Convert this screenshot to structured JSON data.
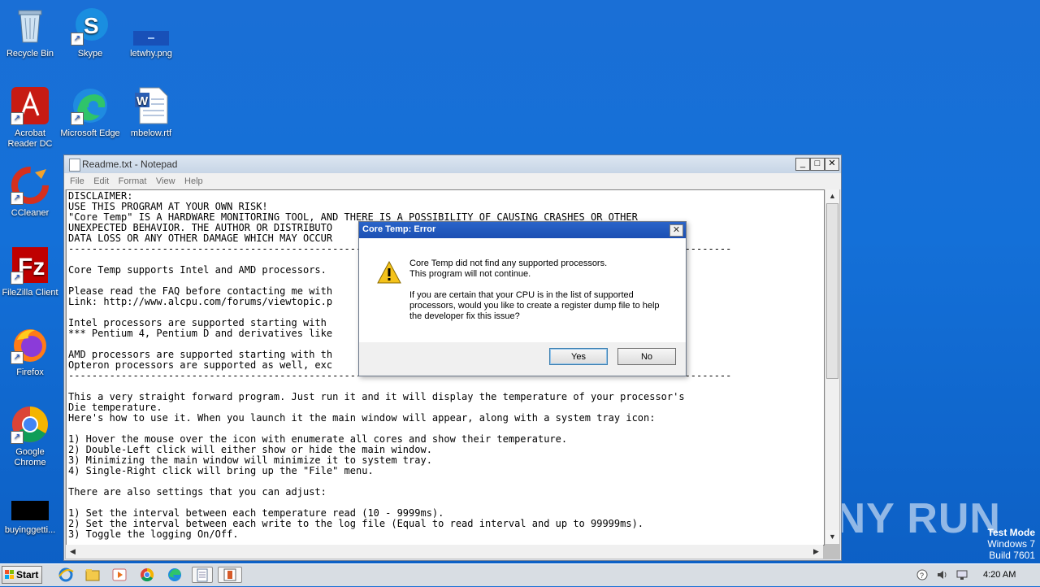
{
  "desktop": {
    "icons": [
      {
        "label": "Recycle Bin"
      },
      {
        "label": "Skype"
      },
      {
        "label": "letwhy.png"
      },
      {
        "label": "Acrobat Reader DC"
      },
      {
        "label": "Microsoft Edge"
      },
      {
        "label": "mbelow.rtf"
      },
      {
        "label": "CCleaner"
      },
      {
        "label": "FileZilla Client"
      },
      {
        "label": "Firefox"
      },
      {
        "label": "Google Chrome"
      },
      {
        "label": "buyinggetti..."
      }
    ],
    "watermark": "ANY RUN",
    "test_mode": {
      "line1": "Test Mode",
      "line2": "Windows 7",
      "line3": "Build 7601"
    }
  },
  "notepad": {
    "title": "Readme.txt - Notepad",
    "menu": [
      "File",
      "Edit",
      "Format",
      "View",
      "Help"
    ],
    "text": "DISCLAIMER:\nUSE THIS PROGRAM AT YOUR OWN RISK!\n\"Core Temp\" IS A HARDWARE MONITORING TOOL, AND THERE IS A POSSIBILITY OF CAUSING CRASHES OR OTHER\nUNEXPECTED BEHAVIOR. THE AUTHOR OR DISTRIBUTO                                        NY\nDATA LOSS OR ANY OTHER DAMAGE WHICH MAY OCCUR\n-----------------------------------------------------------------------------------------------------------------\n\nCore Temp supports Intel and AMD processors.\n\nPlease read the FAQ before contacting me with\nLink: http://www.alcpu.com/forums/viewtopic.p\n\nIntel processors are supported starting with\n*** Pentium 4, Pentium D and derivatives like\n\nAMD processors are supported starting with th\nOpteron processors are supported as well, exc\n-----------------------------------------------------------------------------------------------------------------\n\nThis a very straight forward program. Just run it and it will display the temperature of your processor's\nDie temperature.\nHere's how to use it. When you launch it the main window will appear, along with a system tray icon:\n\n1) Hover the mouse over the icon with enumerate all cores and show their temperature.\n2) Double-Left click will either show or hide the main window.\n3) Minimizing the main window will minimize it to system tray.\n4) Single-Right click will bring up the \"File\" menu.\n\nThere are also settings that you can adjust:\n\n1) Set the interval between each temperature read (10 - 9999ms).\n2) Set the interval between each write to the log file (Equal to read interval and up to 99999ms).\n3) Toggle the logging On/Off."
  },
  "dialog": {
    "title": "Core Temp: Error",
    "line1": "Core Temp did not find any supported processors.",
    "line2": "This program will not continue.",
    "question": "If you are certain that your CPU is in the list of supported processors, would you like to create a register dump file to help the developer fix this issue?",
    "yes": "Yes",
    "no": "No"
  },
  "taskbar": {
    "start": "Start",
    "time": "4:20 AM"
  }
}
